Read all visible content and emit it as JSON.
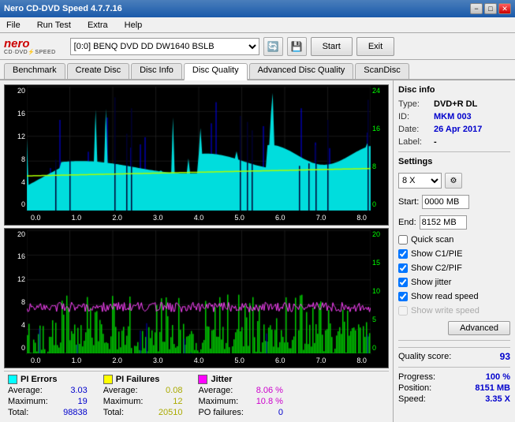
{
  "window": {
    "title": "Nero CD-DVD Speed 4.7.7.16",
    "minimize": "−",
    "maximize": "□",
    "close": "✕"
  },
  "menu": {
    "items": [
      "File",
      "Run Test",
      "Extra",
      "Help"
    ]
  },
  "toolbar": {
    "logo_nero": "nero",
    "logo_sub": "CD·DVD⚡SPEED",
    "drive_label": "[0:0]  BENQ DVD DD DW1640 BSLB",
    "start_label": "Start",
    "exit_label": "Exit"
  },
  "tabs": [
    {
      "label": "Benchmark",
      "active": false
    },
    {
      "label": "Create Disc",
      "active": false
    },
    {
      "label": "Disc Info",
      "active": false
    },
    {
      "label": "Disc Quality",
      "active": true
    },
    {
      "label": "Advanced Disc Quality",
      "active": false
    },
    {
      "label": "ScanDisc",
      "active": false
    }
  ],
  "chart_top": {
    "y_left": [
      "20",
      "16",
      "12",
      "8",
      "4",
      "0"
    ],
    "y_right": [
      "24",
      "16",
      "8",
      "0"
    ],
    "x_labels": [
      "0.0",
      "1.0",
      "2.0",
      "3.0",
      "4.0",
      "5.0",
      "6.0",
      "7.0",
      "8.0"
    ]
  },
  "chart_bottom": {
    "y_left": [
      "20",
      "16",
      "12",
      "8",
      "4",
      "0"
    ],
    "y_right": [
      "20",
      "15",
      "10",
      "5",
      "0"
    ],
    "x_labels": [
      "0.0",
      "1.0",
      "2.0",
      "3.0",
      "4.0",
      "5.0",
      "6.0",
      "7.0",
      "8.0"
    ]
  },
  "stats": {
    "pi_errors": {
      "label": "PI Errors",
      "color": "#00ffff",
      "average_label": "Average:",
      "average_val": "3.03",
      "maximum_label": "Maximum:",
      "maximum_val": "19",
      "total_label": "Total:",
      "total_val": "98838"
    },
    "pi_failures": {
      "label": "PI Failures",
      "color": "#ffff00",
      "average_label": "Average:",
      "average_val": "0.08",
      "maximum_label": "Maximum:",
      "maximum_val": "12",
      "total_label": "Total:",
      "total_val": "20510"
    },
    "jitter": {
      "label": "Jitter",
      "color": "#ff00ff",
      "average_label": "Average:",
      "average_val": "8.06 %",
      "maximum_label": "Maximum:",
      "maximum_val": "10.8 %",
      "po_label": "PO failures:",
      "po_val": "0"
    }
  },
  "disc_info": {
    "title": "Disc info",
    "type_label": "Type:",
    "type_val": "DVD+R DL",
    "id_label": "ID:",
    "id_val": "MKM 003",
    "date_label": "Date:",
    "date_val": "26 Apr 2017",
    "label_label": "Label:",
    "label_val": "-"
  },
  "settings": {
    "title": "Settings",
    "speed_val": "8 X",
    "start_label": "Start:",
    "start_val": "0000 MB",
    "end_label": "End:",
    "end_val": "8152 MB"
  },
  "checkboxes": [
    {
      "label": "Quick scan",
      "checked": false
    },
    {
      "label": "Show C1/PIE",
      "checked": true
    },
    {
      "label": "Show C2/PIF",
      "checked": true
    },
    {
      "label": "Show jitter",
      "checked": true
    },
    {
      "label": "Show read speed",
      "checked": true
    },
    {
      "label": "Show write speed",
      "checked": false,
      "disabled": true
    }
  ],
  "buttons": {
    "advanced": "Advanced"
  },
  "quality": {
    "label": "Quality score:",
    "val": "93"
  },
  "progress": {
    "progress_label": "Progress:",
    "progress_val": "100 %",
    "position_label": "Position:",
    "position_val": "8151 MB",
    "speed_label": "Speed:",
    "speed_val": "3.35 X"
  }
}
